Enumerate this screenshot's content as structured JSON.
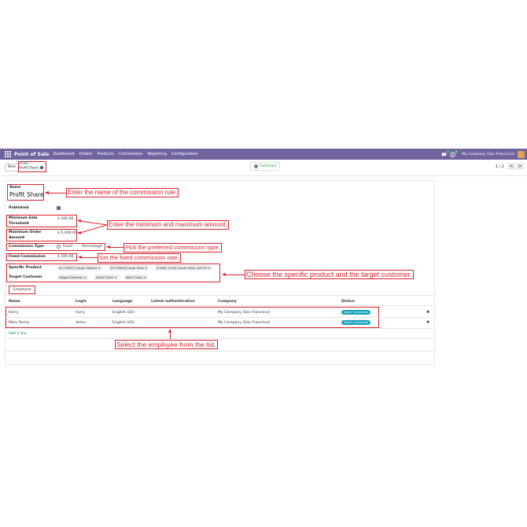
{
  "navbar": {
    "brand": "Point of Sale",
    "menu": [
      "Dashboard",
      "Orders",
      "Products",
      "Commission",
      "Reporting",
      "Configuration"
    ],
    "messages_badge": "7",
    "activity_badge": "8",
    "company": "My Company (San Francisco)"
  },
  "control": {
    "new_label": "New",
    "breadcrumb_parent": "Rules",
    "breadcrumb_current": "Profit Share",
    "published_label": "Published",
    "pager": "1 / 2",
    "prev": "<",
    "next": ">"
  },
  "form": {
    "name_label": "Name",
    "name_value": "Profit Share",
    "published_label": "Published",
    "min_label_1": "Minimum Sale",
    "min_label_2": "Threshold",
    "min_value": "$ 100.00",
    "max_label_1": "Maximum Order",
    "max_label_2": "Amount",
    "max_value": "$ 5,000.00",
    "commission_type_label": "Commission Type",
    "type_fixed": "Fixed",
    "type_percentage": "Percentage",
    "fixed_label": "Fixed Commission",
    "fixed_value": "$ 100.00",
    "product_label": "Specific Product",
    "products": [
      "[E-COM07] Large Cabinet ×",
      "[E-COM09] Large Desk ×",
      "[FURN_1118] Corner Desk Left Sit ×"
    ],
    "customer_label": "Target Customer",
    "customers": [
      "Abigail Peterson ×",
      "Anita Oliver ×",
      "Beth Evans ×"
    ],
    "tab_employee": "Employee"
  },
  "table": {
    "headers": [
      "Name",
      "Login",
      "Language",
      "Latest authentication",
      "Company",
      "Status"
    ],
    "rows": [
      {
        "name": "Harry",
        "login": "harry",
        "language": "English (US)",
        "company": "My Company (San Francisco)",
        "status": "Never Connected"
      },
      {
        "name": "Marc Demo",
        "login": "demo",
        "language": "English (US)",
        "company": "My Company (San Francisco)",
        "status": "Never Connected"
      }
    ],
    "add_line": "Add a line",
    "delete": "✖"
  },
  "annotations": {
    "name": "Enter the name of the commission rule.",
    "minmax": "Enter the minimum and maximum amount.",
    "type": "Pick the preferred commission type.",
    "rate": "Set the fixed commission rate.",
    "product": "Choose the specific product and the target customer.",
    "employee": "Select the employee from the list."
  },
  "colors": {
    "brand": "#71639e",
    "annotation": "#d9232d",
    "status": "#17a2b8"
  }
}
